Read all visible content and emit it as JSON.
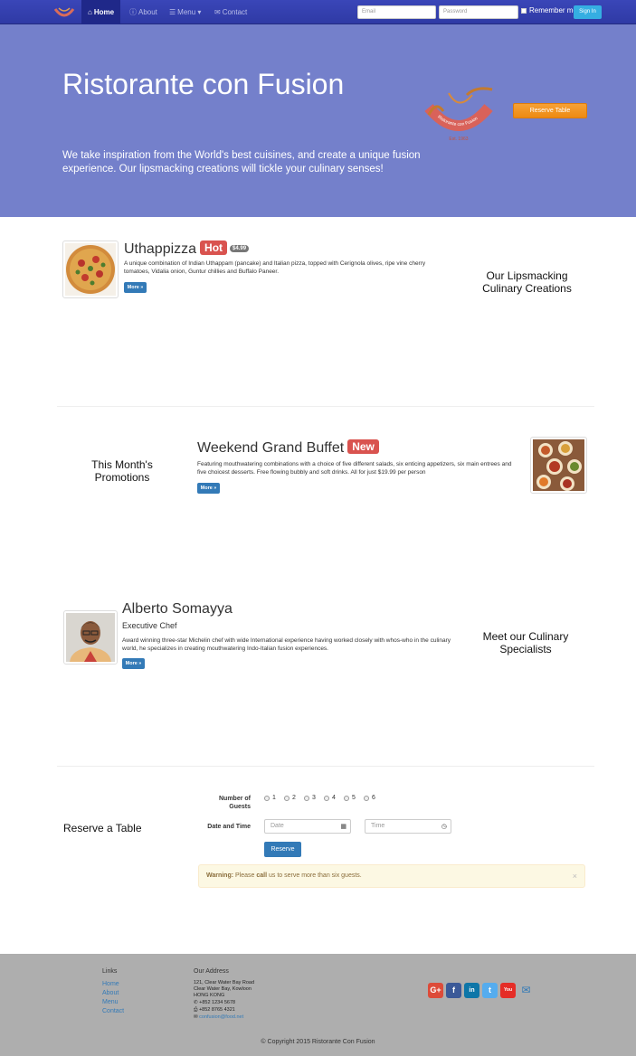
{
  "nav": {
    "home": "Home",
    "about": "About",
    "menu": "Menu",
    "contact": "Contact",
    "email_placeholder": "Email",
    "password_placeholder": "Password",
    "remember": "Remember me",
    "signin": "Sign In"
  },
  "jumbotron": {
    "title": "Ristorante con Fusion",
    "description": "We take inspiration from the World's best cuisines, and create a unique fusion experience. Our lipsmacking creations will tickle your culinary senses!",
    "reserve": "Reserve Table",
    "seal_text": "Ristorante con Fusion",
    "seal_est": "Est. 1963"
  },
  "dish": {
    "title": "Uthappizza",
    "badge": "Hot",
    "price": "$4.99",
    "description": "A unique combination of Indian Uthappam (pancake) and Italian pizza, topped with Cerignola olives, ripe vine cherry tomatoes, Vidalia onion, Guntur chillies and Buffalo Paneer.",
    "more": "More »",
    "side_heading": "Our Lipsmacking Culinary Creations"
  },
  "promotion": {
    "side_heading": "This Month's Promotions",
    "title": "Weekend Grand Buffet",
    "badge": "New",
    "description": "Featuring mouthwatering combinations with a choice of five different salads, six enticing appetizers, six main entrees and five choicest desserts. Free flowing bubbly and soft drinks. All for just $19.99 per person",
    "more": "More »"
  },
  "chef": {
    "name": "Alberto Somayya",
    "role": "Executive Chef",
    "description": "Award winning three-star Michelin chef with wide International experience having worked closely with whos-who in the culinary world, he specializes in creating mouthwatering Indo-Italian fusion experiences.",
    "more": "More »",
    "side_heading": "Meet our Culinary Specialists"
  },
  "reserve": {
    "heading": "Reserve a Table",
    "guests_label": "Number of Guests",
    "guest_options": [
      "1",
      "2",
      "3",
      "4",
      "5",
      "6"
    ],
    "datetime_label": "Date and Time",
    "date_placeholder": "Date",
    "time_placeholder": "Time",
    "submit": "Reserve",
    "warning_strong": "Warning:",
    "warning_text1": " Please ",
    "warning_call": "call",
    "warning_text2": " us to serve more than six guests.",
    "dismiss": "×"
  },
  "footer": {
    "links_heading": "Links",
    "links": [
      "Home",
      "About",
      "Menu",
      "Contact"
    ],
    "address_heading": "Our Address",
    "address": [
      "121, Clear Water Bay Road",
      "Clear Water Bay, Kowloon",
      "HONG KONG"
    ],
    "phone": "+852 1234 5678",
    "fax": "+852 8765 4321",
    "email": "confusion@food.net",
    "social": [
      "G+",
      "f",
      "in",
      "t",
      "You"
    ],
    "copyright": "© Copyright 2015 Ristorante Con Fusion"
  }
}
